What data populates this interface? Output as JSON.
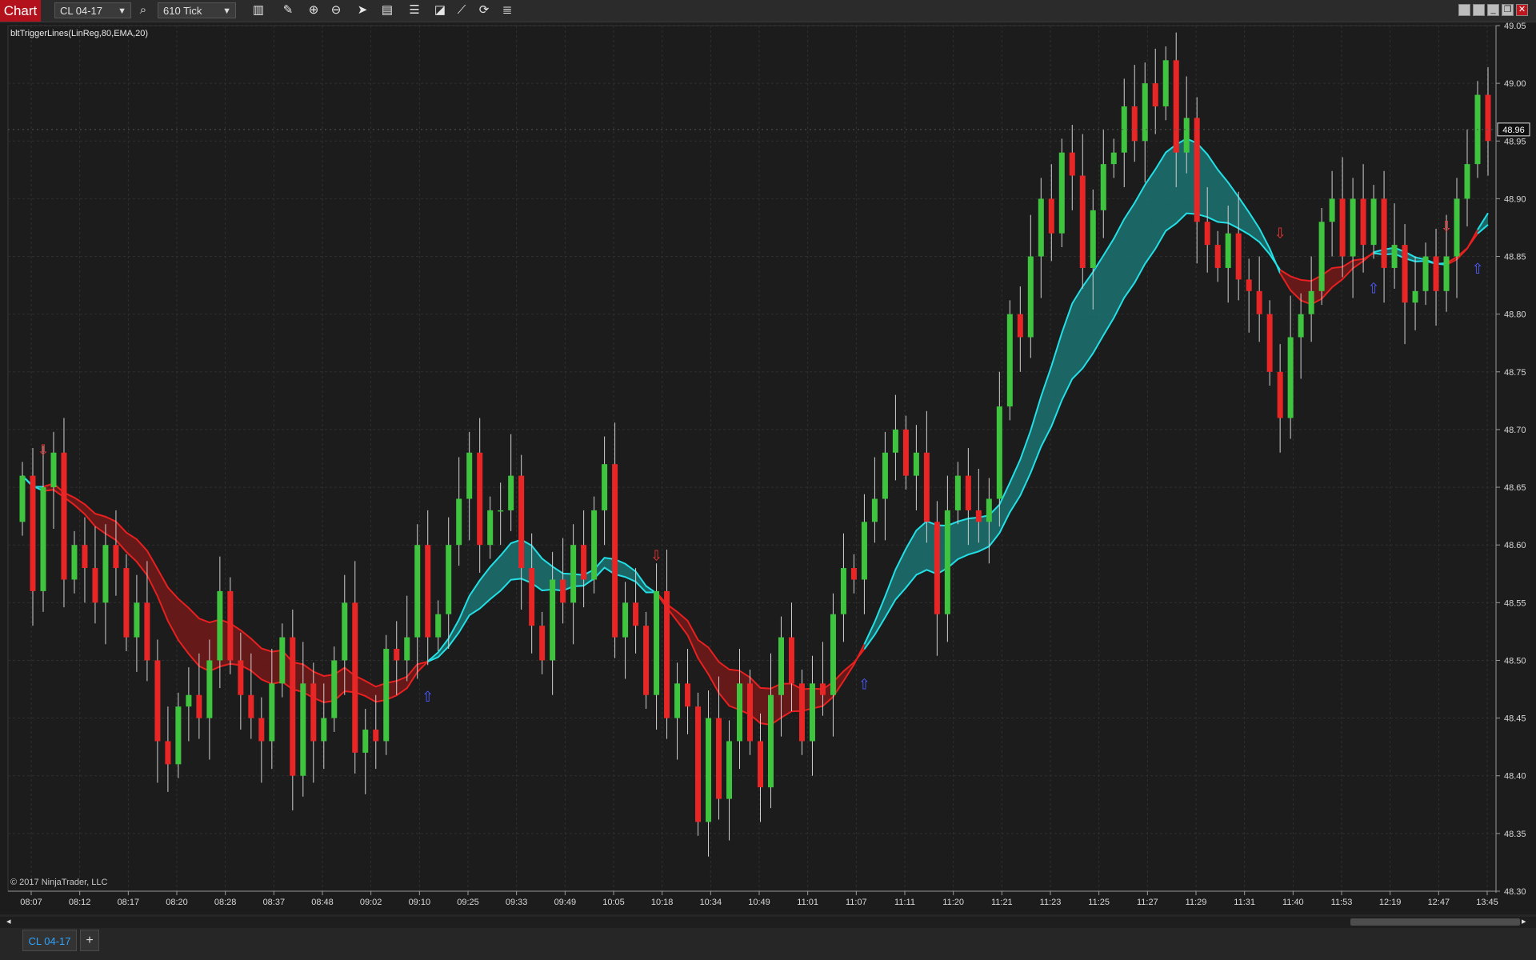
{
  "toolbar": {
    "chart_button": "Chart",
    "instrument": "CL 04-17",
    "period": "610 Tick",
    "icons": [
      "search-icon",
      "bar-type-icon",
      "drawing-pencil-icon",
      "zoom-in-icon",
      "zoom-out-icon",
      "pointer-icon",
      "data-box-icon",
      "chart-trader-icon",
      "properties-icon",
      "strategies-icon",
      "reload-icon",
      "indicators-list-icon"
    ]
  },
  "window_controls": [
    "tile-icon",
    "tile-icon",
    "minimize-icon",
    "restore-icon",
    "close-icon"
  ],
  "indicator": {
    "label": "bltTriggerLines(LinReg,80,EMA,20)"
  },
  "copyright": "© 2017 NinjaTrader, LLC",
  "chart_data": {
    "type": "candlestick",
    "ylim": [
      48.3,
      49.05
    ],
    "y_ticks": [
      "49.05",
      "49.00",
      "48.95",
      "48.90",
      "48.85",
      "48.80",
      "48.75",
      "48.70",
      "48.65",
      "48.60",
      "48.55",
      "48.50",
      "48.45",
      "48.40",
      "48.35",
      "48.30"
    ],
    "current_price": "48.96",
    "x_ticks": [
      "08:07",
      "08:12",
      "08:17",
      "08:20",
      "08:28",
      "08:37",
      "08:48",
      "09:02",
      "09:10",
      "09:25",
      "09:33",
      "09:49",
      "10:05",
      "10:18",
      "10:34",
      "10:49",
      "11:01",
      "11:07",
      "11:11",
      "11:20",
      "11:21",
      "11:23",
      "11:25",
      "11:27",
      "11:29",
      "11:31",
      "11:40",
      "11:53",
      "12:19",
      "12:47",
      "13:45"
    ],
    "colors": {
      "up": "#3fc43f",
      "down": "#e82626",
      "band_up": "#1d6e6e",
      "band_up_line": "#23e0e6",
      "band_down": "#6e1a1a",
      "band_down_line": "#e82020",
      "signal_up": "#4c5bff",
      "signal_down": "#e83535"
    },
    "closes": [
      48.66,
      48.56,
      48.65,
      48.68,
      48.57,
      48.6,
      48.58,
      48.55,
      48.6,
      48.58,
      48.52,
      48.55,
      48.5,
      48.43,
      48.41,
      48.46,
      48.47,
      48.45,
      48.5,
      48.56,
      48.5,
      48.47,
      48.45,
      48.43,
      48.48,
      48.52,
      48.4,
      48.48,
      48.43,
      48.45,
      48.5,
      48.55,
      48.42,
      48.44,
      48.43,
      48.51,
      48.5,
      48.52,
      48.6,
      48.52,
      48.54,
      48.6,
      48.64,
      48.68,
      48.6,
      48.63,
      48.63,
      48.66,
      48.58,
      48.53,
      48.5,
      48.57,
      48.55,
      48.6,
      48.57,
      48.63,
      48.67,
      48.52,
      48.55,
      48.53,
      48.47,
      48.56,
      48.45,
      48.48,
      48.46,
      48.36,
      48.45,
      48.38,
      48.43,
      48.48,
      48.43,
      48.39,
      48.47,
      48.52,
      48.48,
      48.43,
      48.48,
      48.47,
      48.54,
      48.58,
      48.57,
      48.62,
      48.64,
      48.68,
      48.7,
      48.66,
      48.68,
      48.62,
      48.54,
      48.63,
      48.66,
      48.63,
      48.62,
      48.64,
      48.72,
      48.8,
      48.78,
      48.85,
      48.9,
      48.87,
      48.94,
      48.92,
      48.84,
      48.89,
      48.93,
      48.94,
      48.98,
      48.95,
      49.0,
      48.98,
      49.02,
      48.94,
      48.97,
      48.88,
      48.86,
      48.84,
      48.87,
      48.83,
      48.82,
      48.8,
      48.75,
      48.71,
      48.78,
      48.8,
      48.82,
      48.88,
      48.9,
      48.85,
      48.9,
      48.86,
      48.9,
      48.84,
      48.86,
      48.81,
      48.82,
      48.85,
      48.82,
      48.85,
      48.9,
      48.93,
      48.99,
      48.95
    ]
  },
  "bottom": {
    "tab_label": "CL 04-17",
    "add_tab": "+"
  }
}
